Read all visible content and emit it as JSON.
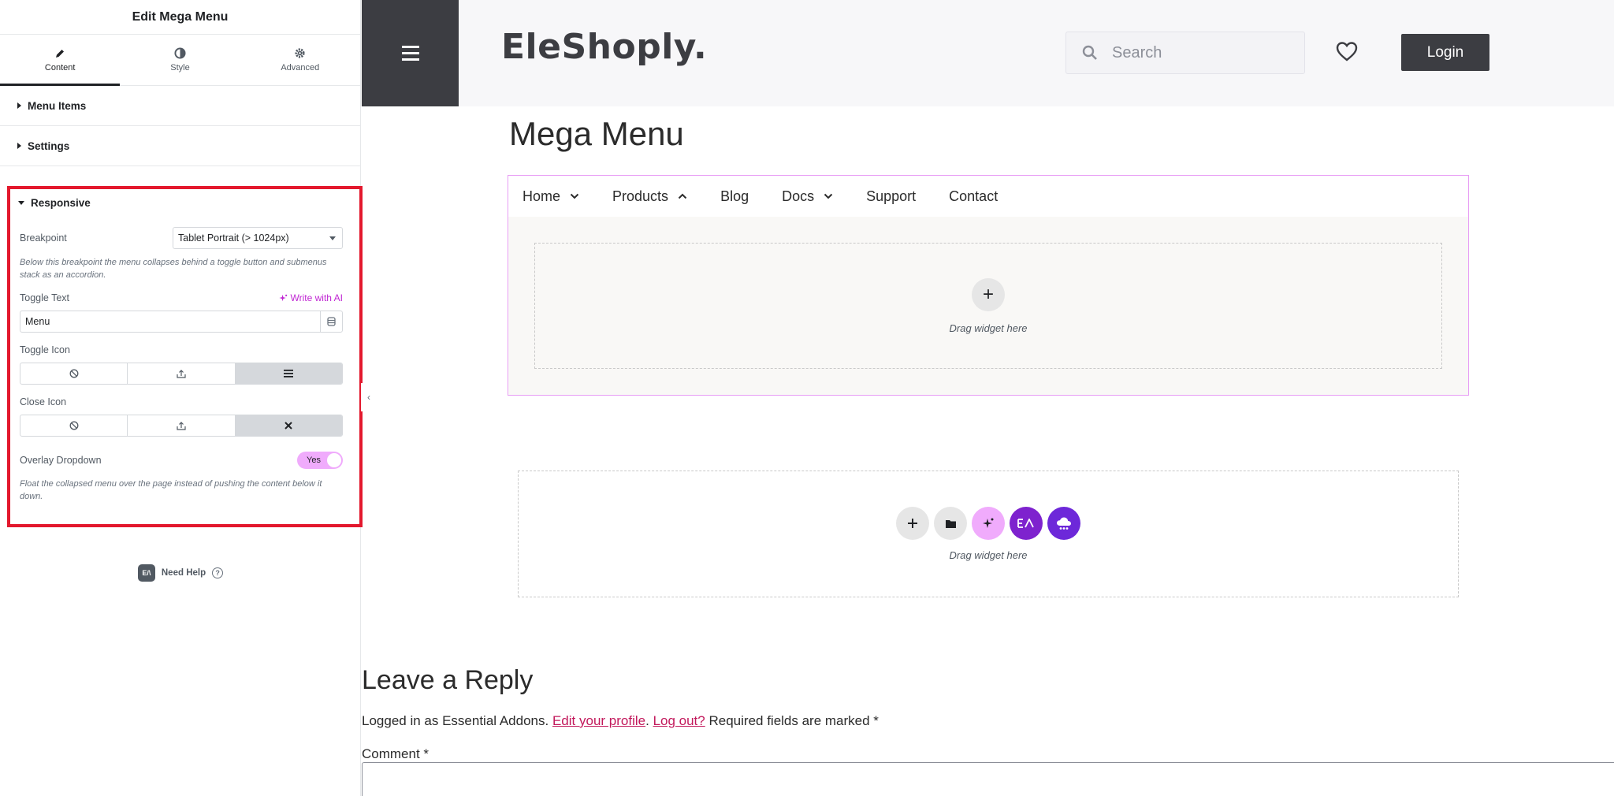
{
  "panel": {
    "title": "Edit Mega Menu",
    "tabs": [
      {
        "label": "Content",
        "icon": "pencil-icon",
        "active": true
      },
      {
        "label": "Style",
        "icon": "half-circle-icon",
        "active": false
      },
      {
        "label": "Advanced",
        "icon": "gear-icon",
        "active": false
      }
    ],
    "sections": {
      "menu_items": "Menu Items",
      "settings": "Settings",
      "responsive": "Responsive"
    },
    "responsive": {
      "breakpoint_label": "Breakpoint",
      "breakpoint_value": "Tablet Portrait (> 1024px)",
      "breakpoint_desc": "Below this breakpoint the menu collapses behind a toggle button and submenus stack as an accordion.",
      "toggle_text_label": "Toggle Text",
      "write_ai": "Write with AI",
      "toggle_text_value": "Menu",
      "toggle_icon_label": "Toggle Icon",
      "close_icon_label": "Close Icon",
      "overlay_label": "Overlay Dropdown",
      "overlay_value": "Yes",
      "overlay_desc": "Float the collapsed menu over the page instead of pushing the content below it down."
    },
    "need_help": "Need Help",
    "ea_logo": "E/\\",
    "accent": "#e3182d"
  },
  "site": {
    "logo": "EleShoply.",
    "search_placeholder": "Search",
    "login": "Login",
    "dark": "#3c3d42"
  },
  "page": {
    "title": "Mega Menu",
    "menu": [
      {
        "label": "Home",
        "caret": "down"
      },
      {
        "label": "Products",
        "caret": "up"
      },
      {
        "label": "Blog",
        "caret": ""
      },
      {
        "label": "Docs",
        "caret": "down"
      },
      {
        "label": "Support",
        "caret": ""
      },
      {
        "label": "Contact",
        "caret": ""
      }
    ],
    "drag_text": "Drag widget here",
    "drag_text_2": "Drag widget here"
  },
  "comments": {
    "title": "Leave a Reply",
    "logged_prefix": "Logged in as Essential Addons.",
    "edit_profile": "Edit your profile",
    "log_out": "Log out?",
    "required": "Required fields are marked *",
    "comment_label": "Comment *"
  }
}
